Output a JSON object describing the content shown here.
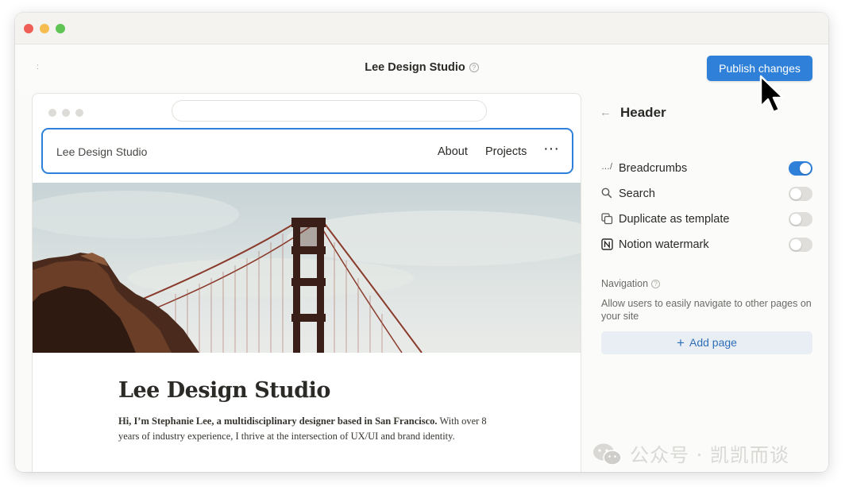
{
  "window": {
    "traffic_lights": [
      "#ee5f57",
      "#f5bd4f",
      "#5fc454"
    ]
  },
  "topbar": {
    "left_marker": ":",
    "site_title": "Lee Design Studio",
    "help_icon": "?",
    "publish_label": "Publish changes",
    "accent": "#2f80d8"
  },
  "preview": {
    "brand": "Lee Design Studio",
    "nav": {
      "about": "About",
      "projects": "Projects",
      "more": "···"
    },
    "heading": "Lee Design Studio",
    "intro_bold": "Hi, I’m Stephanie Lee, a multidisciplinary designer based in San Francisco.",
    "intro_rest": " With over 8 years of industry experience, I thrive at the intersection of UX/UI and brand identity.",
    "hero_image": "golden-gate-bridge-photo"
  },
  "panel": {
    "back_icon": "←",
    "title": "Header",
    "options": [
      {
        "icon": "breadcrumbs-icon",
        "icon_text": "…/",
        "label": "Breadcrumbs",
        "enabled": true
      },
      {
        "icon": "search-icon",
        "icon_text": "",
        "label": "Search",
        "enabled": false
      },
      {
        "icon": "duplicate-icon",
        "icon_text": "",
        "label": "Duplicate as template",
        "enabled": false
      },
      {
        "icon": "notion-icon",
        "icon_text": "",
        "label": "Notion watermark",
        "enabled": false
      }
    ],
    "navigation_heading": "Navigation",
    "navigation_description": "Allow users to easily navigate to other pages on your site",
    "add_page_label": "Add page",
    "add_page_icon": "+"
  },
  "watermark": {
    "text": "公众号 · 凯凯而谈"
  }
}
